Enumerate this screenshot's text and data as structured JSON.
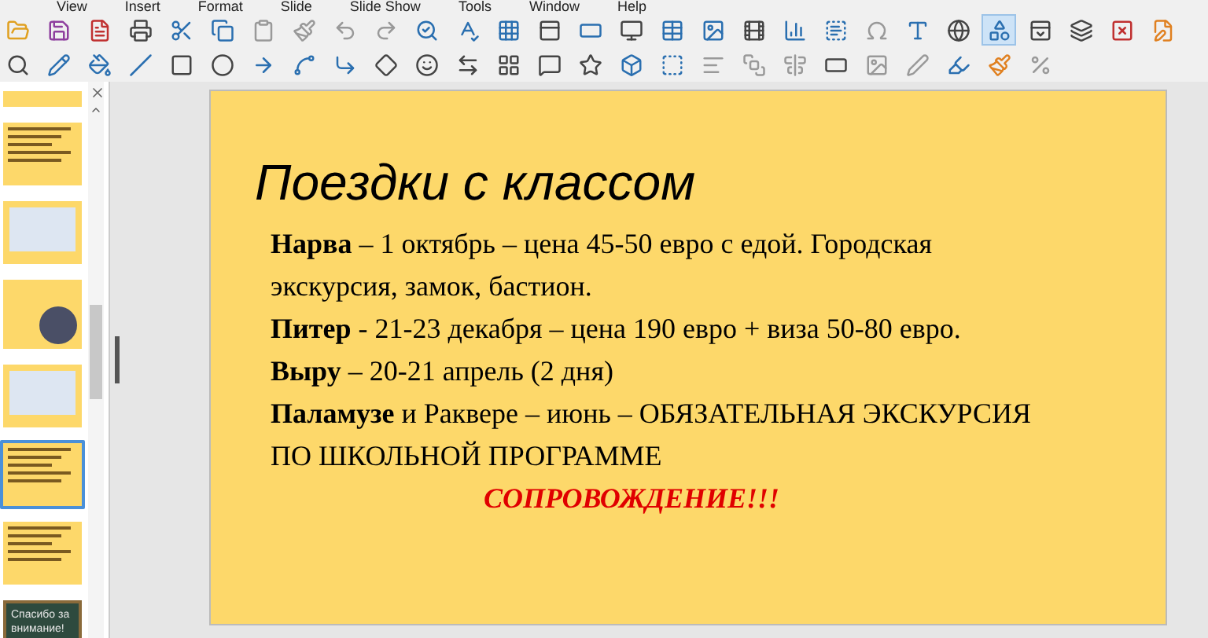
{
  "menu": [
    "View",
    "Insert",
    "Format",
    "Slide",
    "Slide Show",
    "Tools",
    "Window",
    "Help"
  ],
  "draw_functions_button": {
    "selected": true
  },
  "slide_panel": {
    "thumbnails": [
      {
        "kind": "partial",
        "selected": false
      },
      {
        "kind": "text",
        "selected": false
      },
      {
        "kind": "table",
        "selected": false
      },
      {
        "kind": "photo",
        "selected": false
      },
      {
        "kind": "table",
        "selected": false
      },
      {
        "kind": "text",
        "selected": true
      },
      {
        "kind": "text",
        "selected": false
      },
      {
        "kind": "closing",
        "selected": false,
        "text": "Спасибо за внимание!"
      }
    ]
  },
  "slide": {
    "title": "Поездки с классом",
    "paragraphs": [
      {
        "kind": "normal",
        "text": "**Нарва** – 1 октябрь – цена 45-50 евро с едой. Городская экскурсия, замок, бастион."
      },
      {
        "kind": "normal",
        "text": "**Питер**  - 21-23 декабря – цена 190 евро + виза 50-80 евро."
      },
      {
        "kind": "normal",
        "text": "**Выру** – 20-21 апрель (2 дня)"
      },
      {
        "kind": "normal",
        "text": "**Паламузе** и Раквере – июнь – ОБЯЗАТЕЛЬНАЯ ЭКСКУРСИЯ ПО ШКОЛЬНОЙ ПРОГРАММЕ"
      },
      {
        "kind": "alert",
        "text": "СОПРОВОЖДЕНИЕ!!!"
      }
    ]
  }
}
